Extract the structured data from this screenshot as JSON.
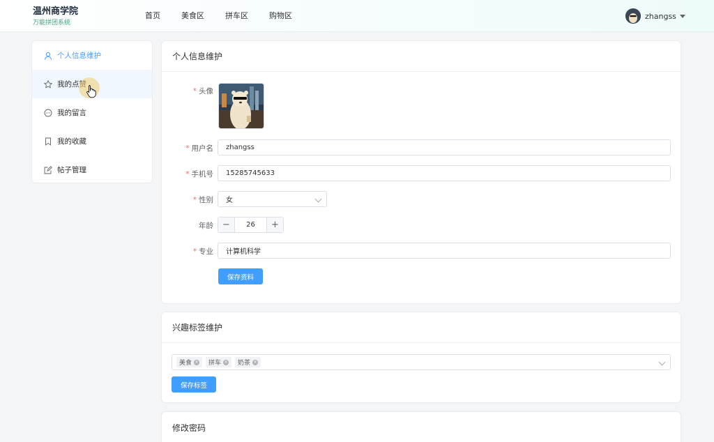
{
  "header": {
    "brand_title": "温州商学院",
    "brand_subtitle": "万能拼团系统",
    "nav": [
      "首页",
      "美食区",
      "拼车区",
      "购物区"
    ],
    "username": "zhangss"
  },
  "sidebar": {
    "items": [
      {
        "label": "个人信息维护",
        "icon": "user-icon"
      },
      {
        "label": "我的点赞",
        "icon": "star-icon"
      },
      {
        "label": "我的留言",
        "icon": "chat-icon"
      },
      {
        "label": "我的收藏",
        "icon": "bookmark-icon"
      },
      {
        "label": "帖子管理",
        "icon": "edit-icon"
      }
    ]
  },
  "profile": {
    "title": "个人信息维护",
    "avatar_label": "头像",
    "username_label": "用户名",
    "username_value": "zhangss",
    "phone_label": "手机号",
    "phone_value": "15285745633",
    "gender_label": "性别",
    "gender_value": "女",
    "age_label": "年龄",
    "age_value": "26",
    "major_label": "专业",
    "major_value": "计算机科学",
    "save_label": "保存资料"
  },
  "tags": {
    "title": "兴趣标签维护",
    "items": [
      "美食",
      "拼车",
      "奶茶"
    ],
    "save_label": "保存标签"
  },
  "password": {
    "title": "修改密码"
  },
  "colors": {
    "primary": "#409eff",
    "required": "#f56c6c",
    "brand_sub": "#3aa57a"
  }
}
